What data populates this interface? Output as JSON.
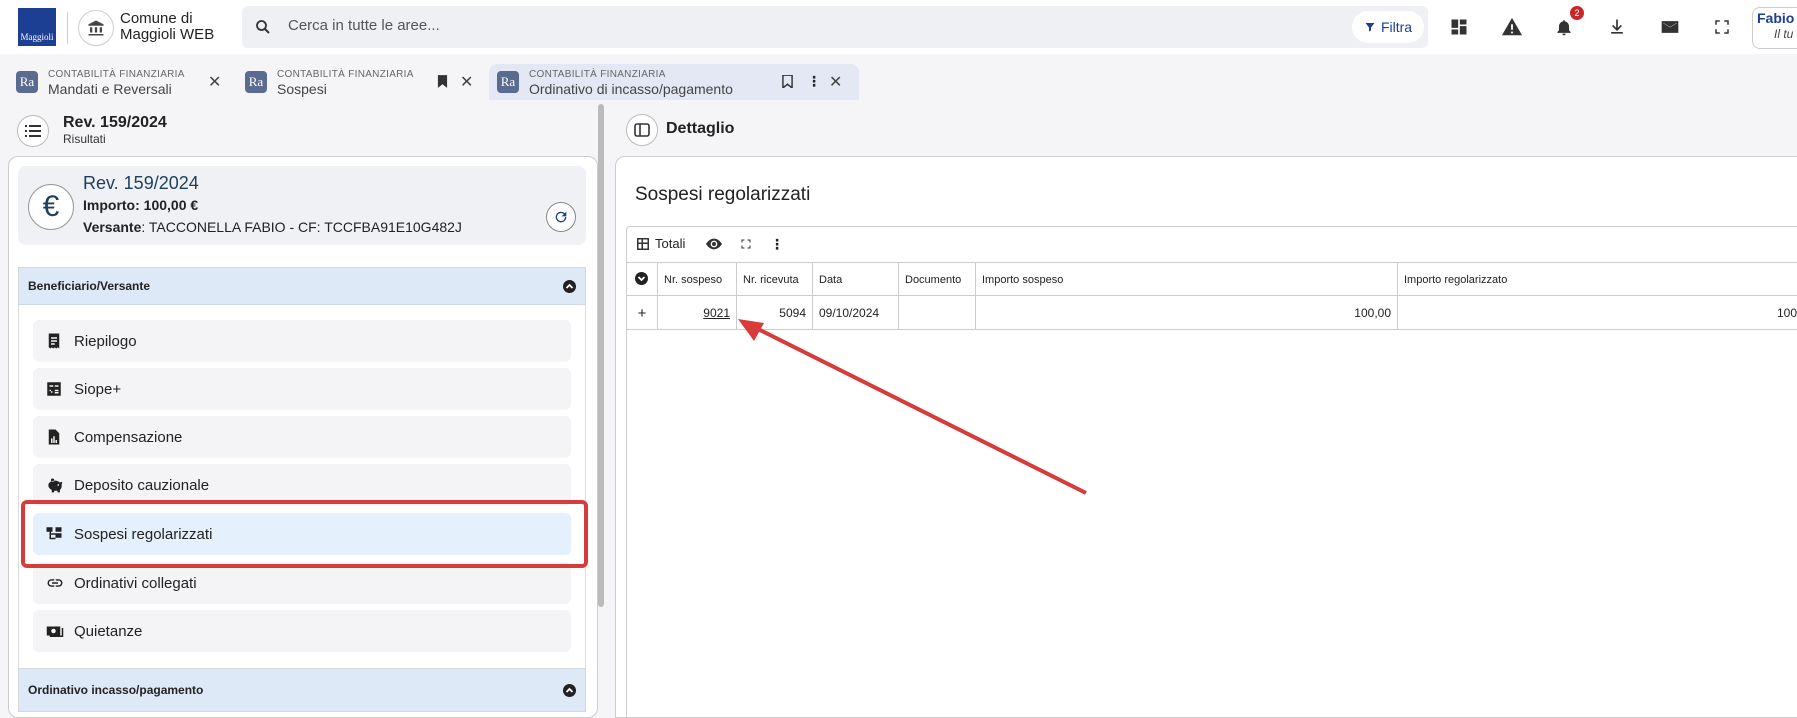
{
  "header": {
    "logo_text": "Maggioli",
    "app_name": "Comune di Maggioli WEB",
    "search_placeholder": "Cerca in tutte le aree...",
    "filter_label": "Filtra",
    "notifications_count": "2",
    "user_name": "Fabio",
    "user_sub": "Il tu"
  },
  "tabs": [
    {
      "section": "CONTABILITÀ FINANZIARIA",
      "title": "Mandati e Reversali",
      "icon_text": "Ra"
    },
    {
      "section": "CONTABILITÀ FINANZIARIA",
      "title": "Sospesi",
      "icon_text": "Ra"
    },
    {
      "section": "CONTABILITÀ FINANZIARIA",
      "title": "Ordinativo di incasso/pagamento",
      "icon_text": "Ra"
    }
  ],
  "left_panel": {
    "title": "Rev. 159/2024",
    "subtitle": "Risultati",
    "summary": {
      "number": "Rev. 159/2024",
      "importo": "Importo: 100,00 €",
      "versante_label": "Versante",
      "versante_value": ": TACCONELLA FABIO - CF: TCCFBA91E10G482J",
      "currency_symbol": "€"
    },
    "section1": "Beneficiario/Versante",
    "menu": [
      {
        "label": "Riepilogo",
        "icon": "receipt-icon"
      },
      {
        "label": "Siope+",
        "icon": "calculator-icon"
      },
      {
        "label": "Compensazione",
        "icon": "report-icon"
      },
      {
        "label": "Deposito cauzionale",
        "icon": "piggy-bank-icon"
      },
      {
        "label": "Sospesi regolarizzati",
        "icon": "tree-icon",
        "active": true
      },
      {
        "label": "Ordinativi collegati",
        "icon": "link-icon"
      },
      {
        "label": "Quietanze",
        "icon": "money-icon"
      }
    ],
    "section2": "Ordinativo incasso/pagamento"
  },
  "right_panel": {
    "title": "Dettaglio",
    "heading": "Sospesi regolarizzati",
    "toolbar": {
      "totals_label": "Totali"
    },
    "table": {
      "columns": [
        "Nr. sospeso",
        "Nr. ricevuta",
        "Data",
        "Documento",
        "Importo sospeso",
        "Importo regolarizzato"
      ],
      "rows": [
        {
          "expand": "+",
          "nr_sospeso": "9021",
          "nr_ricevuta": "5094",
          "data": "09/10/2024",
          "documento": "",
          "importo_sospeso": "100,00",
          "importo_regolarizzato": "100"
        }
      ]
    }
  },
  "colors": {
    "accent": "#1c3f94",
    "highlight": "#d73b3b",
    "section_bg": "#dde9f6"
  }
}
